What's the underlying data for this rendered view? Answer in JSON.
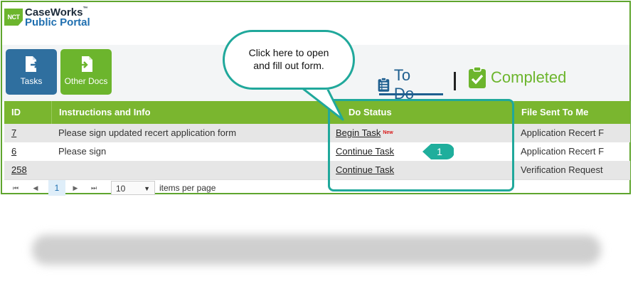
{
  "brand": {
    "logo_badge": "NCT",
    "name_top": "CaseWorks",
    "tm": "™",
    "name_bottom": "Public Portal"
  },
  "toolbar": {
    "tasks_label": "Tasks",
    "tasks_icon": "export-document-icon",
    "other_docs_label": "Other Docs",
    "other_docs_icon": "import-document-icon"
  },
  "tabs": {
    "todo_label": "To Do",
    "todo_icon": "clipboard-list-icon",
    "completed_label": "Completed",
    "completed_icon": "clipboard-check-icon"
  },
  "table": {
    "headers": [
      "ID",
      "Instructions and Info",
      "Do Status",
      "File Sent To Me"
    ],
    "rows": [
      {
        "id": "7",
        "info": "Please sign updated recert application form",
        "status": "Begin Task",
        "badge": "New",
        "file": "Application Recert F"
      },
      {
        "id": "6",
        "info": "Please sign",
        "status": "Continue Task",
        "badge": "",
        "file": "Application Recert F"
      },
      {
        "id": "258",
        "info": "",
        "status": "Continue Task",
        "badge": "",
        "file": "Verification Request"
      }
    ]
  },
  "pager": {
    "first": "⏮",
    "prev": "◀",
    "current_page": "1",
    "next": "▶",
    "last": "⏭",
    "page_size": "10",
    "page_size_label": "items per page"
  },
  "annotation": {
    "callout_text_line1": "Click here to open",
    "callout_text_line2": "and fill out form.",
    "marker_number": "1"
  },
  "colors": {
    "brand_green": "#6cb52d",
    "brand_blue": "#2f6f9f",
    "header_green": "#7ab62f",
    "highlight_teal": "#20a89b",
    "badge_red": "#d91a1a"
  }
}
